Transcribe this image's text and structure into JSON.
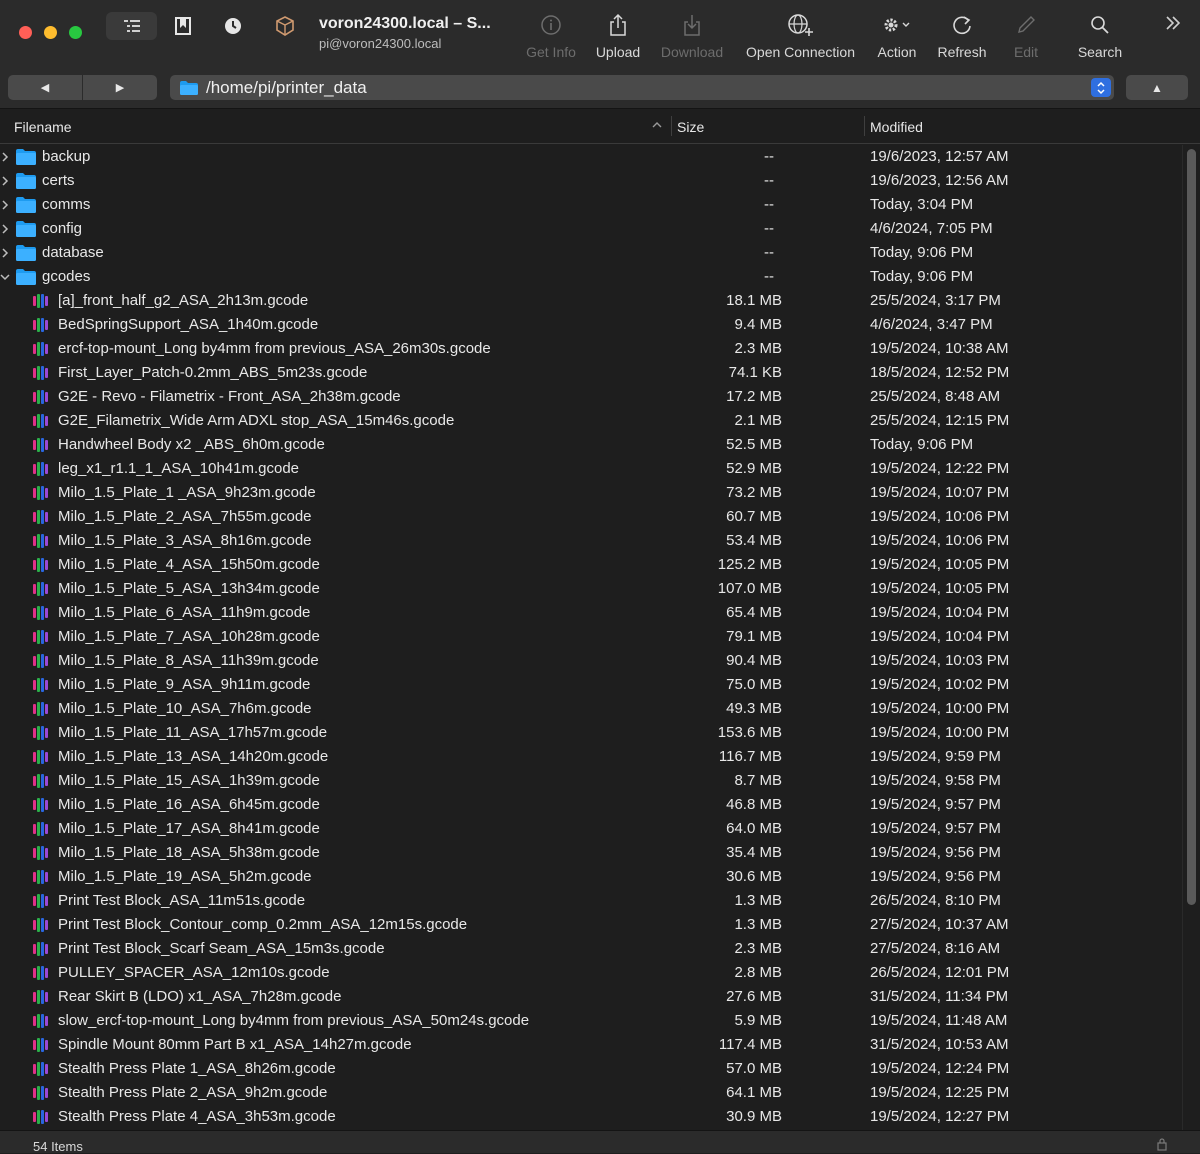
{
  "window": {
    "title": "voron24300.local – S...",
    "subtitle": "pi@voron24300.local"
  },
  "toolbar": {
    "get_info": "Get Info",
    "upload": "Upload",
    "download": "Download",
    "open_connection": "Open Connection",
    "action": "Action",
    "refresh": "Refresh",
    "edit": "Edit",
    "search": "Search"
  },
  "nav": {
    "path": "/home/pi/printer_data"
  },
  "columns": {
    "filename": "Filename",
    "size": "Size",
    "modified": "Modified"
  },
  "folders": [
    {
      "name": "backup",
      "size": "--",
      "modified": "19/6/2023, 12:57 AM",
      "expanded": false
    },
    {
      "name": "certs",
      "size": "--",
      "modified": "19/6/2023, 12:56 AM",
      "expanded": false
    },
    {
      "name": "comms",
      "size": "--",
      "modified": "Today, 3:04 PM",
      "expanded": false
    },
    {
      "name": "config",
      "size": "--",
      "modified": "4/6/2024, 7:05 PM",
      "expanded": false
    },
    {
      "name": "database",
      "size": "--",
      "modified": "Today, 9:06 PM",
      "expanded": false
    },
    {
      "name": "gcodes",
      "size": "--",
      "modified": "Today, 9:06 PM",
      "expanded": true
    }
  ],
  "files": [
    {
      "name": "[a]_front_half_g2_ASA_2h13m.gcode",
      "size": "18.1 MB",
      "modified": "25/5/2024, 3:17 PM"
    },
    {
      "name": "BedSpringSupport_ASA_1h40m.gcode",
      "size": "9.4 MB",
      "modified": "4/6/2024, 3:47 PM"
    },
    {
      "name": "ercf-top-mount_Long by4mm from previous_ASA_26m30s.gcode",
      "size": "2.3 MB",
      "modified": "19/5/2024, 10:38 AM"
    },
    {
      "name": "First_Layer_Patch-0.2mm_ABS_5m23s.gcode",
      "size": "74.1 KB",
      "modified": "18/5/2024, 12:52 PM"
    },
    {
      "name": "G2E - Revo - Filametrix -  Front_ASA_2h38m.gcode",
      "size": "17.2 MB",
      "modified": "25/5/2024, 8:48 AM"
    },
    {
      "name": "G2E_Filametrix_Wide Arm ADXL stop_ASA_15m46s.gcode",
      "size": "2.1 MB",
      "modified": "25/5/2024, 12:15 PM"
    },
    {
      "name": "Handwheel Body x2 _ABS_6h0m.gcode",
      "size": "52.5 MB",
      "modified": "Today, 9:06 PM"
    },
    {
      "name": "leg_x1_r1.1_1_ASA_10h41m.gcode",
      "size": "52.9 MB",
      "modified": "19/5/2024, 12:22 PM"
    },
    {
      "name": "Milo_1.5_Plate_1 _ASA_9h23m.gcode",
      "size": "73.2 MB",
      "modified": "19/5/2024, 10:07 PM"
    },
    {
      "name": "Milo_1.5_Plate_2_ASA_7h55m.gcode",
      "size": "60.7 MB",
      "modified": "19/5/2024, 10:06 PM"
    },
    {
      "name": "Milo_1.5_Plate_3_ASA_8h16m.gcode",
      "size": "53.4 MB",
      "modified": "19/5/2024, 10:06 PM"
    },
    {
      "name": "Milo_1.5_Plate_4_ASA_15h50m.gcode",
      "size": "125.2 MB",
      "modified": "19/5/2024, 10:05 PM"
    },
    {
      "name": "Milo_1.5_Plate_5_ASA_13h34m.gcode",
      "size": "107.0 MB",
      "modified": "19/5/2024, 10:05 PM"
    },
    {
      "name": "Milo_1.5_Plate_6_ASA_11h9m.gcode",
      "size": "65.4 MB",
      "modified": "19/5/2024, 10:04 PM"
    },
    {
      "name": "Milo_1.5_Plate_7_ASA_10h28m.gcode",
      "size": "79.1 MB",
      "modified": "19/5/2024, 10:04 PM"
    },
    {
      "name": "Milo_1.5_Plate_8_ASA_11h39m.gcode",
      "size": "90.4 MB",
      "modified": "19/5/2024, 10:03 PM"
    },
    {
      "name": "Milo_1.5_Plate_9_ASA_9h11m.gcode",
      "size": "75.0 MB",
      "modified": "19/5/2024, 10:02 PM"
    },
    {
      "name": "Milo_1.5_Plate_10_ASA_7h6m.gcode",
      "size": "49.3 MB",
      "modified": "19/5/2024, 10:00 PM"
    },
    {
      "name": "Milo_1.5_Plate_11_ASA_17h57m.gcode",
      "size": "153.6 MB",
      "modified": "19/5/2024, 10:00 PM"
    },
    {
      "name": "Milo_1.5_Plate_13_ASA_14h20m.gcode",
      "size": "116.7 MB",
      "modified": "19/5/2024, 9:59 PM"
    },
    {
      "name": "Milo_1.5_Plate_15_ASA_1h39m.gcode",
      "size": "8.7 MB",
      "modified": "19/5/2024, 9:58 PM"
    },
    {
      "name": "Milo_1.5_Plate_16_ASA_6h45m.gcode",
      "size": "46.8 MB",
      "modified": "19/5/2024, 9:57 PM"
    },
    {
      "name": "Milo_1.5_Plate_17_ASA_8h41m.gcode",
      "size": "64.0 MB",
      "modified": "19/5/2024, 9:57 PM"
    },
    {
      "name": "Milo_1.5_Plate_18_ASA_5h38m.gcode",
      "size": "35.4 MB",
      "modified": "19/5/2024, 9:56 PM"
    },
    {
      "name": "Milo_1.5_Plate_19_ASA_5h2m.gcode",
      "size": "30.6 MB",
      "modified": "19/5/2024, 9:56 PM"
    },
    {
      "name": "Print Test Block_ASA_11m51s.gcode",
      "size": "1.3 MB",
      "modified": "26/5/2024, 8:10 PM"
    },
    {
      "name": "Print Test Block_Contour_comp_0.2mm_ASA_12m15s.gcode",
      "size": "1.3 MB",
      "modified": "27/5/2024, 10:37 AM"
    },
    {
      "name": "Print Test Block_Scarf Seam_ASA_15m3s.gcode",
      "size": "2.3 MB",
      "modified": "27/5/2024, 8:16 AM"
    },
    {
      "name": "PULLEY_SPACER_ASA_12m10s.gcode",
      "size": "2.8 MB",
      "modified": "26/5/2024, 12:01 PM"
    },
    {
      "name": "Rear Skirt B (LDO) x1_ASA_7h28m.gcode",
      "size": "27.6 MB",
      "modified": "31/5/2024, 11:34 PM"
    },
    {
      "name": "slow_ercf-top-mount_Long by4mm from previous_ASA_50m24s.gcode",
      "size": "5.9 MB",
      "modified": "19/5/2024, 11:48 AM"
    },
    {
      "name": "Spindle Mount 80mm Part B x1_ASA_14h27m.gcode",
      "size": "117.4 MB",
      "modified": "31/5/2024, 10:53 AM"
    },
    {
      "name": "Stealth Press Plate 1_ASA_8h26m.gcode",
      "size": "57.0 MB",
      "modified": "19/5/2024, 12:24 PM"
    },
    {
      "name": "Stealth Press Plate 2_ASA_9h2m.gcode",
      "size": "64.1 MB",
      "modified": "19/5/2024, 12:25 PM"
    },
    {
      "name": "Stealth Press Plate 4_ASA_3h53m.gcode",
      "size": "30.9 MB",
      "modified": "19/5/2024, 12:27 PM"
    }
  ],
  "status": {
    "count": "54 Items"
  },
  "colors": {
    "folder_blue": "#1e9bf0",
    "accent": "#2f6fe0"
  }
}
